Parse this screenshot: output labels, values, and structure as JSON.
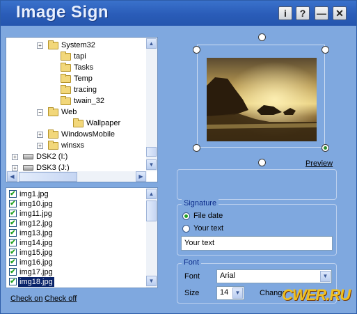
{
  "window": {
    "title": "Image Sign"
  },
  "titlebar_buttons": {
    "info": "i",
    "help": "?",
    "minimize": "—",
    "close": "✕"
  },
  "folder_tree": {
    "items": [
      {
        "label": "System32",
        "expand": "+",
        "kind": "folder"
      },
      {
        "label": "tapi",
        "expand": "",
        "kind": "folder"
      },
      {
        "label": "Tasks",
        "expand": "",
        "kind": "folder"
      },
      {
        "label": "Temp",
        "expand": "",
        "kind": "folder"
      },
      {
        "label": "tracing",
        "expand": "",
        "kind": "folder"
      },
      {
        "label": "twain_32",
        "expand": "",
        "kind": "folder"
      },
      {
        "label": "Web",
        "expand": "−",
        "kind": "folder"
      },
      {
        "label": "Wallpaper",
        "expand": "",
        "kind": "folder"
      },
      {
        "label": "WindowsMobile",
        "expand": "+",
        "kind": "folder"
      },
      {
        "label": "winsxs",
        "expand": "+",
        "kind": "folder"
      },
      {
        "label": "DSK2 (I:)",
        "expand": "+",
        "kind": "drive"
      },
      {
        "label": "DSK3 (J:)",
        "expand": "+",
        "kind": "drive"
      }
    ]
  },
  "file_list": {
    "items": [
      {
        "name": "img1.jpg",
        "checked": true
      },
      {
        "name": "img10.jpg",
        "checked": true
      },
      {
        "name": "img11.jpg",
        "checked": true
      },
      {
        "name": "img12.jpg",
        "checked": true
      },
      {
        "name": "img13.jpg",
        "checked": true
      },
      {
        "name": "img14.jpg",
        "checked": true
      },
      {
        "name": "img15.jpg",
        "checked": true
      },
      {
        "name": "img16.jpg",
        "checked": true
      },
      {
        "name": "img17.jpg",
        "checked": true
      },
      {
        "name": "img18.jpg",
        "checked": true,
        "selected": true
      }
    ]
  },
  "links": {
    "check_on": "Check on",
    "check_off": "Check off",
    "preview": "Preview"
  },
  "signature": {
    "group_title": "Signature",
    "file_date_label": "File date",
    "your_text_label": "Your text",
    "selected": "file_date",
    "text_value": "Your text"
  },
  "font": {
    "group_title": "Font",
    "font_label": "Font",
    "font_value": "Arial",
    "size_label": "Size",
    "size_value": "14",
    "change_label": "Change"
  },
  "watermark": "CWER.RU",
  "colors": {
    "title_bar": "#2a5cb8",
    "window_bg": "#7fa8df",
    "group_title": "#0a2a8a",
    "selection": "#0a246a"
  }
}
